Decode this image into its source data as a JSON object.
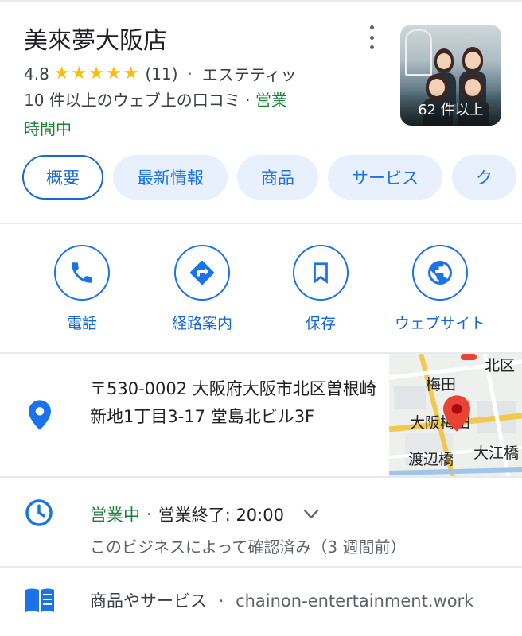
{
  "business": {
    "name": "美來夢大阪店",
    "rating": "4.8",
    "stars": "★★★★★",
    "review_count": "(11)",
    "separator": "·",
    "category": "エステティッ",
    "reviews_text": "10 件以上のウェブ上の口コミ",
    "status_part1": "営業",
    "status_part2": "時間中",
    "photo_count": "62 件以上"
  },
  "tabs": [
    {
      "label": "概要",
      "active": true
    },
    {
      "label": "最新情報"
    },
    {
      "label": "商品"
    },
    {
      "label": "サービス"
    },
    {
      "label": "ク"
    }
  ],
  "actions": [
    {
      "label": "電話",
      "icon": "phone-icon"
    },
    {
      "label": "経路案内",
      "icon": "directions-icon"
    },
    {
      "label": "保存",
      "icon": "bookmark-icon"
    },
    {
      "label": "ウェブサイト",
      "icon": "globe-icon"
    }
  ],
  "address": {
    "text": "〒530-0002 大阪府大阪市北区曽根崎新地1丁目3-17 堂島北ビル3F",
    "map_labels": [
      "北区",
      "梅田",
      "大阪梅田",
      "渡辺橋",
      "大江橋"
    ]
  },
  "hours": {
    "status": "営業中",
    "separator": "·",
    "closing": "営業終了: 20:00",
    "verified": "このビジネスによって確認済み（3 週間前）"
  },
  "products": {
    "label": "商品やサービス",
    "separator": "·",
    "link": "chainon-entertainment.work"
  },
  "colors": {
    "accent": "#1a73e8",
    "chip_bg": "#e8f0fe",
    "open_green": "#188038",
    "star": "#fbbc04",
    "pin_red": "#ea4335"
  }
}
